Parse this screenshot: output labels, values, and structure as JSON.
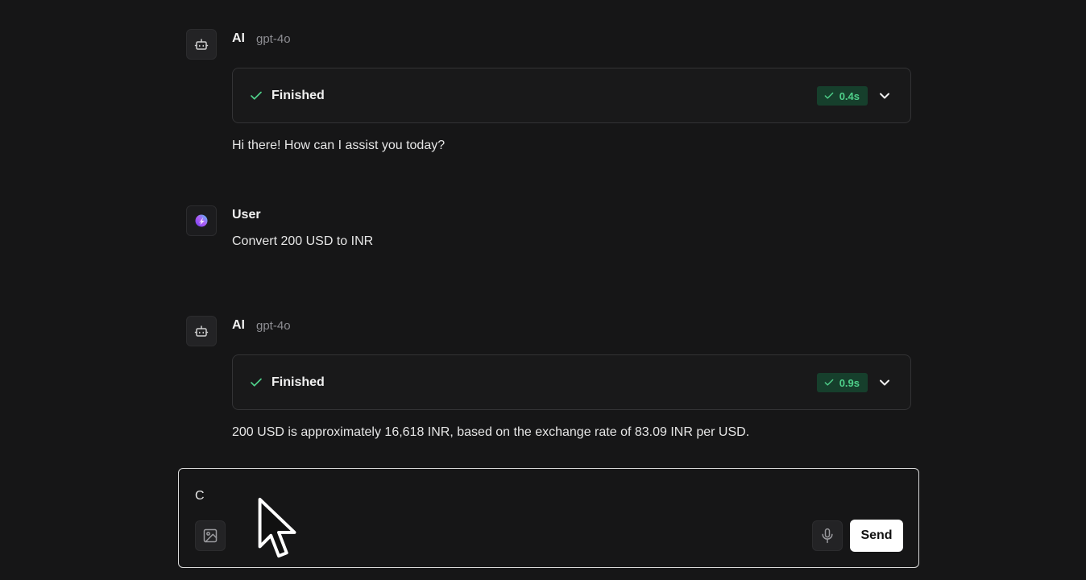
{
  "messages": [
    {
      "role": "ai",
      "name": "AI",
      "model": "gpt-4o",
      "status": "Finished",
      "timing": "0.4s",
      "text": "Hi there! How can I assist you today?"
    },
    {
      "role": "user",
      "name": "User",
      "text": "Convert 200 USD to INR"
    },
    {
      "role": "ai",
      "name": "AI",
      "model": "gpt-4o",
      "status": "Finished",
      "timing": "0.9s",
      "text": "200 USD is approximately 16,618 INR, based on the exchange rate of 83.09 INR per USD."
    }
  ],
  "composer": {
    "value": "C",
    "send_label": "Send"
  },
  "colors": {
    "background": "#161617",
    "success_green": "#4fd08a",
    "badge_bg": "#163f2c"
  },
  "icons": {
    "ai_avatar": "bot-icon",
    "user_avatar": "gradient-orb-icon",
    "status": "check-icon",
    "expand": "chevron-down-icon",
    "attach": "image-icon",
    "voice": "microphone-icon"
  }
}
